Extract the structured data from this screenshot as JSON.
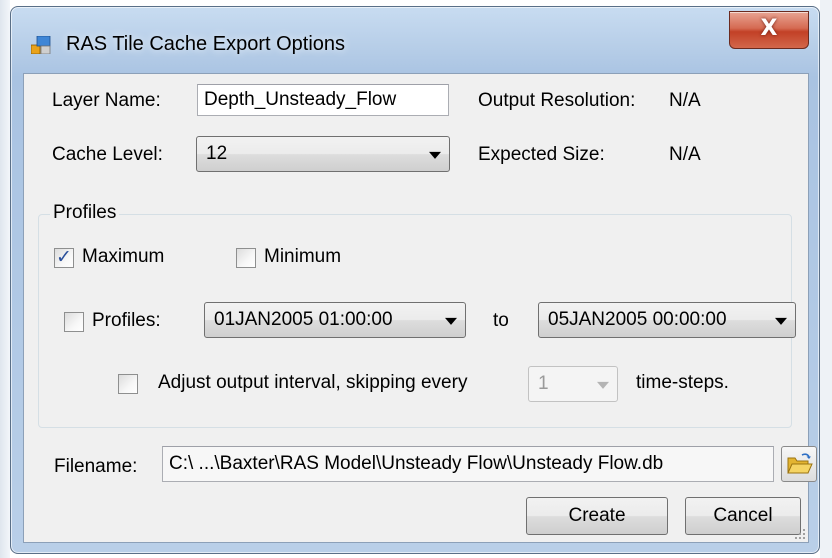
{
  "window": {
    "title": "RAS Tile Cache Export Options",
    "close_glyph": "X"
  },
  "form": {
    "layer_name_label": "Layer Name:",
    "layer_name_value": "Depth_Unsteady_Flow",
    "output_resolution_label": "Output Resolution:",
    "output_resolution_value": "N/A",
    "cache_level_label": "Cache Level:",
    "cache_level_value": "12",
    "expected_size_label": "Expected Size:",
    "expected_size_value": "N/A"
  },
  "profiles_group": {
    "legend": "Profiles",
    "maximum_label": "Maximum",
    "maximum_checked": true,
    "minimum_label": "Minimum",
    "minimum_checked": false,
    "profiles_label": "Profiles:",
    "profiles_checked": false,
    "profile_from_value": "01JAN2005 01:00:00",
    "to_label": "to",
    "profile_to_value": "05JAN2005 00:00:00",
    "adjust_checked": false,
    "adjust_label": "Adjust output interval, skipping every",
    "skip_value": "1",
    "time_steps_label": "time-steps."
  },
  "file": {
    "filename_label": "Filename:",
    "filename_value": "C:\\ ...\\Baxter\\RAS Model\\Unsteady Flow\\Unsteady Flow.db",
    "browse_icon": "folder-open-icon"
  },
  "buttons": {
    "create_label": "Create",
    "cancel_label": "Cancel"
  },
  "colors": {
    "window_frame": "#b9cfe8",
    "close_button": "#c24026",
    "client_background": "#f0f0f0"
  }
}
